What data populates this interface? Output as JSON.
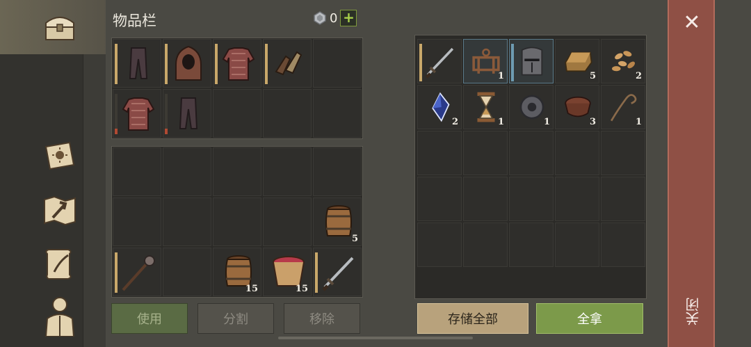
{
  "header": {
    "title": "物品栏",
    "currency_value": "0",
    "currency_add": "+"
  },
  "sidebar": {
    "items": [
      {
        "name": "chest-icon",
        "active": true
      },
      {
        "name": "sun-book-icon"
      },
      {
        "name": "map-icon"
      },
      {
        "name": "scroll-quill-icon"
      },
      {
        "name": "character-icon"
      }
    ]
  },
  "equipment": [
    [
      {
        "icon": "cloth-pants-icon",
        "bar": "full"
      },
      {
        "icon": "hood-icon",
        "bar": "full"
      },
      {
        "icon": "chainmail-icon",
        "bar": "full"
      },
      {
        "icon": "gloves-icon",
        "bar": "full"
      },
      {
        "icon": ""
      }
    ],
    [
      {
        "icon": "chainmail-icon",
        "bar": "red"
      },
      {
        "icon": "cloth-pants-icon",
        "bar": "red"
      },
      {
        "icon": ""
      },
      {
        "icon": ""
      },
      {
        "icon": ""
      }
    ]
  ],
  "inventory": [
    [
      {
        "icon": ""
      },
      {
        "icon": ""
      },
      {
        "icon": ""
      },
      {
        "icon": ""
      },
      {
        "icon": ""
      }
    ],
    [
      {
        "icon": ""
      },
      {
        "icon": ""
      },
      {
        "icon": ""
      },
      {
        "icon": ""
      },
      {
        "icon": "barrel-icon",
        "count": "5"
      }
    ],
    [
      {
        "icon": "mace-icon",
        "bar": "full"
      },
      {
        "icon": ""
      },
      {
        "icon": "barrel-icon",
        "count": "15"
      },
      {
        "icon": "bucket-icon",
        "count": "15"
      },
      {
        "icon": "sword-icon",
        "bar": "full"
      }
    ]
  ],
  "storage": [
    [
      {
        "icon": "sword-icon",
        "bar": "full"
      },
      {
        "icon": "trap-icon",
        "count": "1",
        "highlight": true
      },
      {
        "icon": "helmet-icon",
        "highlight": true,
        "bar": "blue"
      },
      {
        "icon": "ingot-icon",
        "count": "5"
      },
      {
        "icon": "seeds-icon",
        "count": "2"
      }
    ],
    [
      {
        "icon": "crystal-icon",
        "count": "2"
      },
      {
        "icon": "hourglass-icon",
        "count": "1"
      },
      {
        "icon": "gear-icon",
        "count": "1"
      },
      {
        "icon": "leather-icon",
        "count": "3"
      },
      {
        "icon": "rope-icon",
        "count": "1"
      }
    ],
    [
      {
        "icon": ""
      },
      {
        "icon": ""
      },
      {
        "icon": ""
      },
      {
        "icon": ""
      },
      {
        "icon": ""
      }
    ],
    [
      {
        "icon": ""
      },
      {
        "icon": ""
      },
      {
        "icon": ""
      },
      {
        "icon": ""
      },
      {
        "icon": ""
      }
    ],
    [
      {
        "icon": ""
      },
      {
        "icon": ""
      },
      {
        "icon": ""
      },
      {
        "icon": ""
      },
      {
        "icon": ""
      }
    ]
  ],
  "buttons": {
    "use": "使用",
    "split": "分割",
    "remove": "移除",
    "store_all": "存储全部",
    "take_all": "全拿",
    "close": "关闭",
    "close_x": "✕"
  }
}
